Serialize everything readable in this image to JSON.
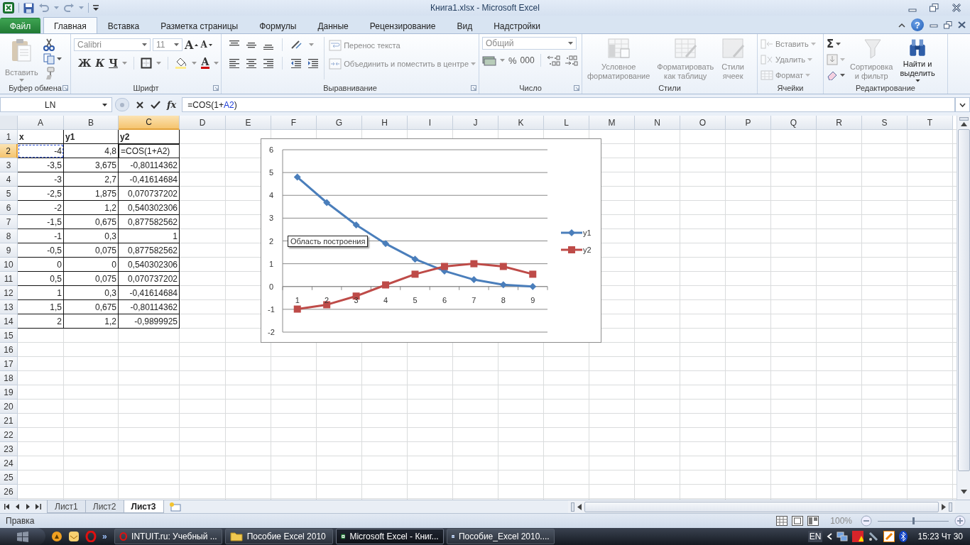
{
  "title_bar": {
    "title": "Книга1.xlsx  -  Microsoft Excel"
  },
  "ribbon_tabs": [
    {
      "label": "Файл",
      "kind": "file",
      "selected": false
    },
    {
      "label": "Главная",
      "kind": "tab",
      "selected": true
    },
    {
      "label": "Вставка",
      "kind": "tab",
      "selected": false
    },
    {
      "label": "Разметка страницы",
      "kind": "tab",
      "selected": false
    },
    {
      "label": "Формулы",
      "kind": "tab",
      "selected": false
    },
    {
      "label": "Данные",
      "kind": "tab",
      "selected": false
    },
    {
      "label": "Рецензирование",
      "kind": "tab",
      "selected": false
    },
    {
      "label": "Вид",
      "kind": "tab",
      "selected": false
    },
    {
      "label": "Надстройки",
      "kind": "tab",
      "selected": false
    }
  ],
  "help": "?",
  "ribbon": {
    "clipboard": {
      "label": "Буфер обмена",
      "paste": {
        "label": "Вставить",
        "disabled": true
      }
    },
    "font": {
      "label": "Шрифт",
      "font_name": {
        "value": "Calibri",
        "disabled": true
      },
      "font_size": {
        "value": "11",
        "disabled": true
      },
      "grow_font": "A",
      "shrink_font": "A",
      "bold": "Ж",
      "italic": "К",
      "underline": "Ч",
      "font_color": "A"
    },
    "alignment": {
      "label": "Выравнивание",
      "wrap_text": {
        "label": "Перенос текста",
        "disabled": true
      },
      "merge": {
        "label": "Объединить и поместить в центре",
        "disabled": true
      }
    },
    "number": {
      "label": "Число",
      "format": {
        "value": "Общий",
        "disabled": true
      },
      "percent": "%",
      "thousands": "000"
    },
    "styles": {
      "label": "Стили",
      "buttons": [
        {
          "label": "Условное\nформатирование",
          "disabled": true
        },
        {
          "label": "Форматировать\nкак таблицу",
          "disabled": true
        },
        {
          "label": "Стили\nячеек",
          "disabled": true
        }
      ]
    },
    "cells": {
      "label": "Ячейки",
      "buttons": [
        {
          "label": "Вставить",
          "disabled": true
        },
        {
          "label": "Удалить",
          "disabled": true
        },
        {
          "label": "Формат",
          "disabled": true
        }
      ]
    },
    "editing": {
      "label": "Редактирование",
      "autosum": "Σ",
      "buttons": [
        {
          "label": "Сортировка\nи фильтр",
          "disabled": true
        },
        {
          "label": "Найти и\nвыделить",
          "disabled": false
        }
      ]
    }
  },
  "formula_bar": {
    "name_box": "LN",
    "function_button": "fx",
    "formula": [
      {
        "text": "=COS(1+",
        "kind": "plain"
      },
      {
        "text": "A2",
        "kind": "reference"
      },
      {
        "text": ")",
        "kind": "plain"
      }
    ]
  },
  "sheet": {
    "columns": [
      {
        "label": "A",
        "selected": false
      },
      {
        "label": "B",
        "selected": false
      },
      {
        "label": "C",
        "selected": true
      },
      {
        "label": "D",
        "selected": false
      },
      {
        "label": "E",
        "selected": false
      },
      {
        "label": "F",
        "selected": false
      },
      {
        "label": "G",
        "selected": false
      },
      {
        "label": "H",
        "selected": false
      },
      {
        "label": "I",
        "selected": false
      },
      {
        "label": "J",
        "selected": false
      },
      {
        "label": "K",
        "selected": false
      },
      {
        "label": "L",
        "selected": false
      },
      {
        "label": "M",
        "selected": false
      },
      {
        "label": "N",
        "selected": false
      },
      {
        "label": "O",
        "selected": false
      },
      {
        "label": "P",
        "selected": false
      },
      {
        "label": "Q",
        "selected": false
      },
      {
        "label": "R",
        "selected": false
      },
      {
        "label": "S",
        "selected": false
      },
      {
        "label": "T",
        "selected": false
      }
    ],
    "rows": [
      {
        "label": "1",
        "selected": false,
        "kind": "header",
        "cells": [
          {
            "text": "x",
            "kind": "plain"
          },
          {
            "text": "y1",
            "kind": "plain"
          },
          {
            "text": "y2",
            "kind": "plain"
          }
        ]
      },
      {
        "label": "2",
        "selected": true,
        "kind": "data",
        "cells": [
          {
            "text": "-4",
            "kind": "reference"
          },
          {
            "text": "4,8",
            "kind": "plain"
          },
          {
            "text": "=COS(1+A2)",
            "kind": "editing"
          }
        ]
      },
      {
        "label": "3",
        "selected": false,
        "kind": "data",
        "cells": [
          {
            "text": "-3,5",
            "kind": "plain"
          },
          {
            "text": "3,675",
            "kind": "plain"
          },
          {
            "text": "-0,80114362",
            "kind": "plain"
          }
        ]
      },
      {
        "label": "4",
        "selected": false,
        "kind": "data",
        "cells": [
          {
            "text": "-3",
            "kind": "plain"
          },
          {
            "text": "2,7",
            "kind": "plain"
          },
          {
            "text": "-0,41614684",
            "kind": "plain"
          }
        ]
      },
      {
        "label": "5",
        "selected": false,
        "kind": "data",
        "cells": [
          {
            "text": "-2,5",
            "kind": "plain"
          },
          {
            "text": "1,875",
            "kind": "plain"
          },
          {
            "text": "0,070737202",
            "kind": "plain"
          }
        ]
      },
      {
        "label": "6",
        "selected": false,
        "kind": "data",
        "cells": [
          {
            "text": "-2",
            "kind": "plain"
          },
          {
            "text": "1,2",
            "kind": "plain"
          },
          {
            "text": "0,540302306",
            "kind": "plain"
          }
        ]
      },
      {
        "label": "7",
        "selected": false,
        "kind": "data",
        "cells": [
          {
            "text": "-1,5",
            "kind": "plain"
          },
          {
            "text": "0,675",
            "kind": "plain"
          },
          {
            "text": "0,877582562",
            "kind": "plain"
          }
        ]
      },
      {
        "label": "8",
        "selected": false,
        "kind": "data",
        "cells": [
          {
            "text": "-1",
            "kind": "plain"
          },
          {
            "text": "0,3",
            "kind": "plain"
          },
          {
            "text": "1",
            "kind": "plain"
          }
        ]
      },
      {
        "label": "9",
        "selected": false,
        "kind": "data",
        "cells": [
          {
            "text": "-0,5",
            "kind": "plain"
          },
          {
            "text": "0,075",
            "kind": "plain"
          },
          {
            "text": "0,877582562",
            "kind": "plain"
          }
        ]
      },
      {
        "label": "10",
        "selected": false,
        "kind": "data",
        "cells": [
          {
            "text": "0",
            "kind": "plain"
          },
          {
            "text": "0",
            "kind": "plain"
          },
          {
            "text": "0,540302306",
            "kind": "plain"
          }
        ]
      },
      {
        "label": "11",
        "selected": false,
        "kind": "data",
        "cells": [
          {
            "text": "0,5",
            "kind": "plain"
          },
          {
            "text": "0,075",
            "kind": "plain"
          },
          {
            "text": "0,070737202",
            "kind": "plain"
          }
        ]
      },
      {
        "label": "12",
        "selected": false,
        "kind": "data",
        "cells": [
          {
            "text": "1",
            "kind": "plain"
          },
          {
            "text": "0,3",
            "kind": "plain"
          },
          {
            "text": "-0,41614684",
            "kind": "plain"
          }
        ]
      },
      {
        "label": "13",
        "selected": false,
        "kind": "data",
        "cells": [
          {
            "text": "1,5",
            "kind": "plain"
          },
          {
            "text": "0,675",
            "kind": "plain"
          },
          {
            "text": "-0,80114362",
            "kind": "plain"
          }
        ]
      },
      {
        "label": "14",
        "selected": false,
        "kind": "data",
        "cells": [
          {
            "text": "2",
            "kind": "plain"
          },
          {
            "text": "1,2",
            "kind": "plain"
          },
          {
            "text": "-0,9899925",
            "kind": "plain"
          }
        ]
      },
      {
        "label": "15",
        "selected": false
      },
      {
        "label": "16",
        "selected": false
      },
      {
        "label": "17",
        "selected": false
      },
      {
        "label": "18",
        "selected": false
      },
      {
        "label": "19",
        "selected": false
      },
      {
        "label": "20",
        "selected": false
      },
      {
        "label": "21",
        "selected": false
      },
      {
        "label": "22",
        "selected": false
      },
      {
        "label": "23",
        "selected": false
      },
      {
        "label": "24",
        "selected": false
      },
      {
        "label": "25",
        "selected": false
      },
      {
        "label": "26",
        "selected": false
      }
    ]
  },
  "chart": {
    "tooltip": "Область построения",
    "chart_data": {
      "type": "line",
      "categories": [
        "1",
        "2",
        "3",
        "4",
        "5",
        "6",
        "7",
        "8",
        "9"
      ],
      "series": [
        {
          "name": "y1",
          "color": "#4a7ebb",
          "marker": "diamond",
          "values": [
            4.8,
            3.68,
            2.7,
            1.88,
            1.2,
            0.68,
            0.3,
            0.08,
            0
          ]
        },
        {
          "name": "y2",
          "color": "#be4b48",
          "marker": "square",
          "values": [
            -0.99,
            -0.8,
            -0.42,
            0.07,
            0.54,
            0.88,
            1,
            0.88,
            0.54
          ]
        }
      ],
      "ylim": [
        -2,
        6
      ],
      "yticks": [
        -2,
        -1,
        0,
        1,
        2,
        3,
        4,
        5,
        6
      ],
      "grid": true,
      "legend": true
    }
  },
  "sheet_tabs": [
    {
      "label": "Лист1",
      "selected": false
    },
    {
      "label": "Лист2",
      "selected": false
    },
    {
      "label": "Лист3",
      "selected": true
    }
  ],
  "status_bar": {
    "mode": "Правка",
    "zoom": "100%",
    "zoom_slider": {
      "level": 0.5
    }
  },
  "taskbar": {
    "overflow": "»",
    "buttons": [
      {
        "label": "INTUIT.ru: Учебный ...",
        "kind": "browser",
        "selected": false
      },
      {
        "label": "Пособие Excel 2010",
        "kind": "folder",
        "selected": false
      },
      {
        "label": "Microsoft Excel - Книг...",
        "kind": "excel",
        "selected": true
      },
      {
        "label": "Пособие_Excel 2010....",
        "kind": "word",
        "selected": false
      }
    ],
    "language": "EN",
    "clock": "15:23 Чт 30"
  }
}
